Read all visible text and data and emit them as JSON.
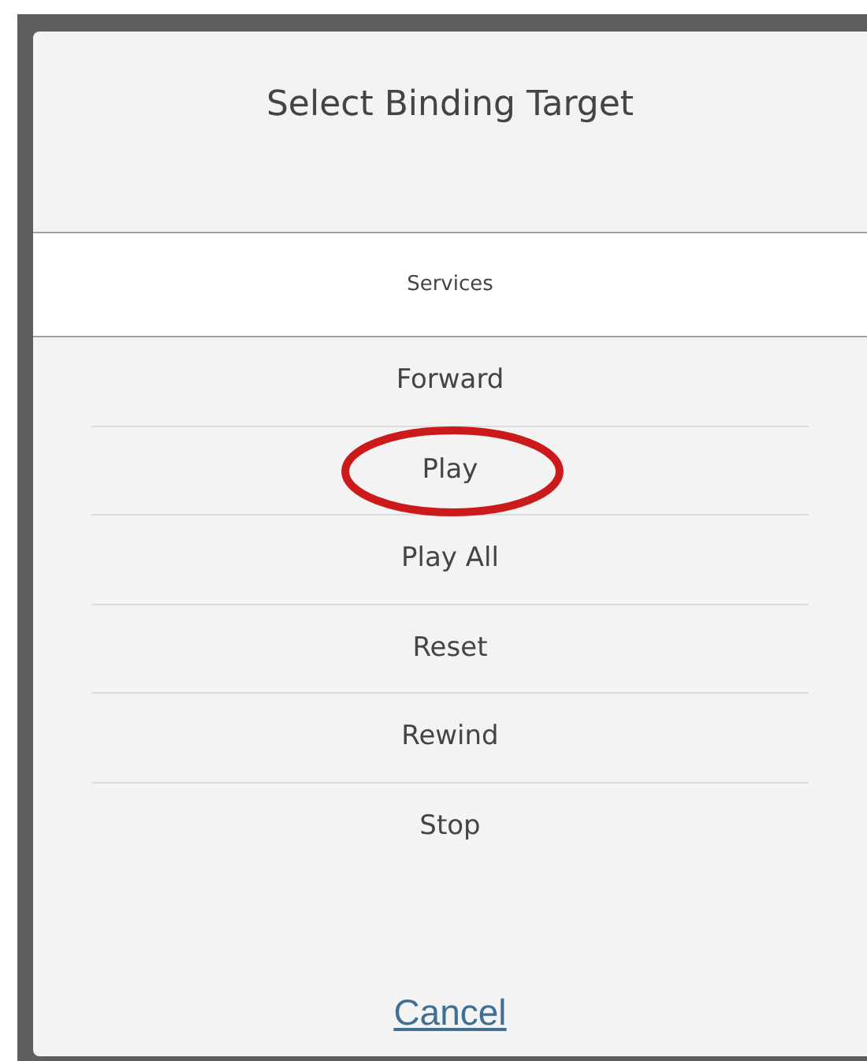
{
  "dialog": {
    "title": "Select Binding Target",
    "section_header": "Services",
    "items": [
      {
        "label": "Forward",
        "circled": false
      },
      {
        "label": "Play",
        "circled": true
      },
      {
        "label": "Play All",
        "circled": false
      },
      {
        "label": "Reset",
        "circled": false
      },
      {
        "label": "Rewind",
        "circled": false
      },
      {
        "label": "Stop",
        "circled": false
      }
    ],
    "cancel": "Cancel"
  }
}
